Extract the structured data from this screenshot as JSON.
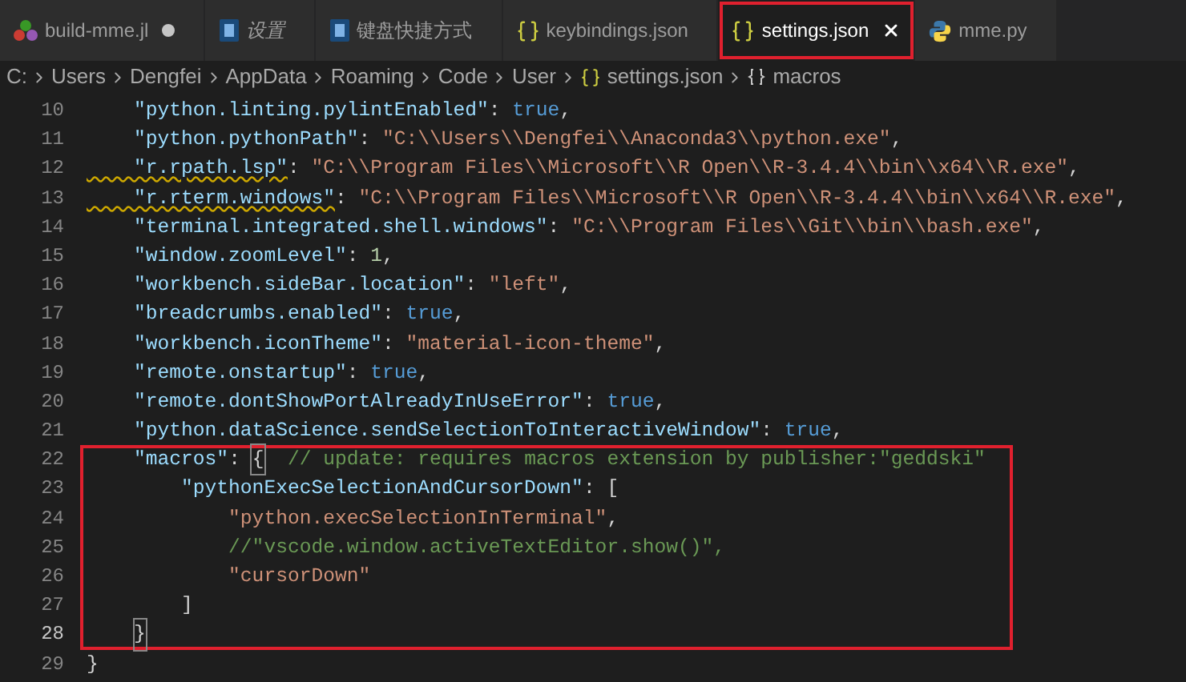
{
  "tabs": [
    {
      "label": "build-mme.jl",
      "kind": "julia",
      "italic": false,
      "selected": false,
      "modified": true,
      "marked": false
    },
    {
      "label": "设置",
      "kind": "settings",
      "italic": true,
      "selected": false,
      "modified": false,
      "marked": false
    },
    {
      "label": "键盘快捷方式",
      "kind": "settings",
      "italic": false,
      "selected": false,
      "modified": false,
      "marked": false
    },
    {
      "label": "keybindings.json",
      "kind": "json",
      "italic": false,
      "selected": false,
      "modified": false,
      "marked": false
    },
    {
      "label": "settings.json",
      "kind": "json",
      "italic": false,
      "selected": true,
      "modified": false,
      "marked": true
    },
    {
      "label": "mme.py",
      "kind": "python",
      "italic": false,
      "selected": false,
      "modified": false,
      "marked": false
    }
  ],
  "breadcrumbs": [
    {
      "label": "C:",
      "kind": "folder"
    },
    {
      "label": "Users",
      "kind": "folder"
    },
    {
      "label": "Dengfei",
      "kind": "folder"
    },
    {
      "label": "AppData",
      "kind": "folder"
    },
    {
      "label": "Roaming",
      "kind": "folder"
    },
    {
      "label": "Code",
      "kind": "folder"
    },
    {
      "label": "User",
      "kind": "folder"
    },
    {
      "label": "settings.json",
      "kind": "json"
    },
    {
      "label": "macros",
      "kind": "object"
    }
  ],
  "lines": [
    {
      "number": "10",
      "boxed": false,
      "current": false,
      "warning": false,
      "tokens": [
        {
          "kind": "key",
          "text": "    \"python.linting.pylintEnabled\""
        },
        {
          "kind": "punct",
          "text": ": "
        },
        {
          "kind": "bool",
          "text": "true"
        },
        {
          "kind": "punct",
          "text": ","
        }
      ]
    },
    {
      "number": "11",
      "boxed": false,
      "current": false,
      "warning": false,
      "tokens": [
        {
          "kind": "key",
          "text": "    \"python.pythonPath\""
        },
        {
          "kind": "punct",
          "text": ": "
        },
        {
          "kind": "string",
          "text": "\"C:\\\\Users\\\\Dengfei\\\\Anaconda3\\\\python.exe\""
        },
        {
          "kind": "punct",
          "text": ","
        }
      ]
    },
    {
      "number": "12",
      "boxed": false,
      "current": false,
      "warning": true,
      "tokens": [
        {
          "kind": "key",
          "text": "    \"r.rpath.lsp\""
        },
        {
          "kind": "punct",
          "text": ": "
        },
        {
          "kind": "string",
          "text": "\"C:\\\\Program Files\\\\Microsoft\\\\R Open\\\\R-3.4.4\\\\bin\\\\x64\\\\R.exe\""
        },
        {
          "kind": "punct",
          "text": ","
        }
      ]
    },
    {
      "number": "13",
      "boxed": false,
      "current": false,
      "warning": true,
      "tokens": [
        {
          "kind": "key",
          "text": "    \"r.rterm.windows\""
        },
        {
          "kind": "punct",
          "text": ": "
        },
        {
          "kind": "string",
          "text": "\"C:\\\\Program Files\\\\Microsoft\\\\R Open\\\\R-3.4.4\\\\bin\\\\x64\\\\R.exe\""
        },
        {
          "kind": "punct",
          "text": ","
        }
      ]
    },
    {
      "number": "14",
      "boxed": false,
      "current": false,
      "warning": false,
      "tokens": [
        {
          "kind": "key",
          "text": "    \"terminal.integrated.shell.windows\""
        },
        {
          "kind": "punct",
          "text": ": "
        },
        {
          "kind": "string",
          "text": "\"C:\\\\Program Files\\\\Git\\\\bin\\\\bash.exe\""
        },
        {
          "kind": "punct",
          "text": ","
        }
      ]
    },
    {
      "number": "15",
      "boxed": false,
      "current": false,
      "warning": false,
      "tokens": [
        {
          "kind": "key",
          "text": "    \"window.zoomLevel\""
        },
        {
          "kind": "punct",
          "text": ": "
        },
        {
          "kind": "number",
          "text": "1"
        },
        {
          "kind": "punct",
          "text": ","
        }
      ]
    },
    {
      "number": "16",
      "boxed": false,
      "current": false,
      "warning": false,
      "tokens": [
        {
          "kind": "key",
          "text": "    \"workbench.sideBar.location\""
        },
        {
          "kind": "punct",
          "text": ": "
        },
        {
          "kind": "string",
          "text": "\"left\""
        },
        {
          "kind": "punct",
          "text": ","
        }
      ]
    },
    {
      "number": "17",
      "boxed": false,
      "current": false,
      "warning": false,
      "tokens": [
        {
          "kind": "key",
          "text": "    \"breadcrumbs.enabled\""
        },
        {
          "kind": "punct",
          "text": ": "
        },
        {
          "kind": "bool",
          "text": "true"
        },
        {
          "kind": "punct",
          "text": ","
        }
      ]
    },
    {
      "number": "18",
      "boxed": false,
      "current": false,
      "warning": false,
      "tokens": [
        {
          "kind": "key",
          "text": "    \"workbench.iconTheme\""
        },
        {
          "kind": "punct",
          "text": ": "
        },
        {
          "kind": "string",
          "text": "\"material-icon-theme\""
        },
        {
          "kind": "punct",
          "text": ","
        }
      ]
    },
    {
      "number": "19",
      "boxed": false,
      "current": false,
      "warning": false,
      "tokens": [
        {
          "kind": "key",
          "text": "    \"remote.onstartup\""
        },
        {
          "kind": "punct",
          "text": ": "
        },
        {
          "kind": "bool",
          "text": "true"
        },
        {
          "kind": "punct",
          "text": ","
        }
      ]
    },
    {
      "number": "20",
      "boxed": false,
      "current": false,
      "warning": false,
      "tokens": [
        {
          "kind": "key",
          "text": "    \"remote.dontShowPortAlreadyInUseError\""
        },
        {
          "kind": "punct",
          "text": ": "
        },
        {
          "kind": "bool",
          "text": "true"
        },
        {
          "kind": "punct",
          "text": ","
        }
      ]
    },
    {
      "number": "21",
      "boxed": false,
      "current": false,
      "warning": false,
      "tokens": [
        {
          "kind": "key",
          "text": "    \"python.dataScience.sendSelectionToInteractiveWindow\""
        },
        {
          "kind": "punct",
          "text": ": "
        },
        {
          "kind": "bool",
          "text": "true"
        },
        {
          "kind": "punct",
          "text": ","
        }
      ]
    },
    {
      "number": "22",
      "boxed": true,
      "current": false,
      "warning": false,
      "tokens": [
        {
          "kind": "key",
          "text": "    \"macros\""
        },
        {
          "kind": "punct",
          "text": ": "
        },
        {
          "kind": "match",
          "text": "{"
        },
        {
          "kind": "comment",
          "text": "  // update: requires macros extension by publisher:\"geddski\""
        }
      ]
    },
    {
      "number": "23",
      "boxed": true,
      "current": false,
      "warning": false,
      "tokens": [
        {
          "kind": "key",
          "text": "        \"pythonExecSelectionAndCursorDown\""
        },
        {
          "kind": "punct",
          "text": ": ["
        }
      ]
    },
    {
      "number": "24",
      "boxed": true,
      "current": false,
      "warning": false,
      "tokens": [
        {
          "kind": "string",
          "text": "            \"python.execSelectionInTerminal\""
        },
        {
          "kind": "punct",
          "text": ","
        }
      ]
    },
    {
      "number": "25",
      "boxed": true,
      "current": false,
      "warning": false,
      "tokens": [
        {
          "kind": "comment",
          "text": "            //\"vscode.window.activeTextEditor.show()\","
        }
      ]
    },
    {
      "number": "26",
      "boxed": true,
      "current": false,
      "warning": false,
      "tokens": [
        {
          "kind": "string",
          "text": "            \"cursorDown\""
        }
      ]
    },
    {
      "number": "27",
      "boxed": true,
      "current": false,
      "warning": false,
      "tokens": [
        {
          "kind": "punct",
          "text": "        ]"
        }
      ]
    },
    {
      "number": "28",
      "boxed": true,
      "current": true,
      "warning": false,
      "tokens": [
        {
          "kind": "match",
          "text": "    }"
        }
      ]
    },
    {
      "number": "29",
      "boxed": false,
      "current": false,
      "warning": false,
      "tokens": [
        {
          "kind": "punct",
          "text": "}"
        }
      ]
    }
  ]
}
